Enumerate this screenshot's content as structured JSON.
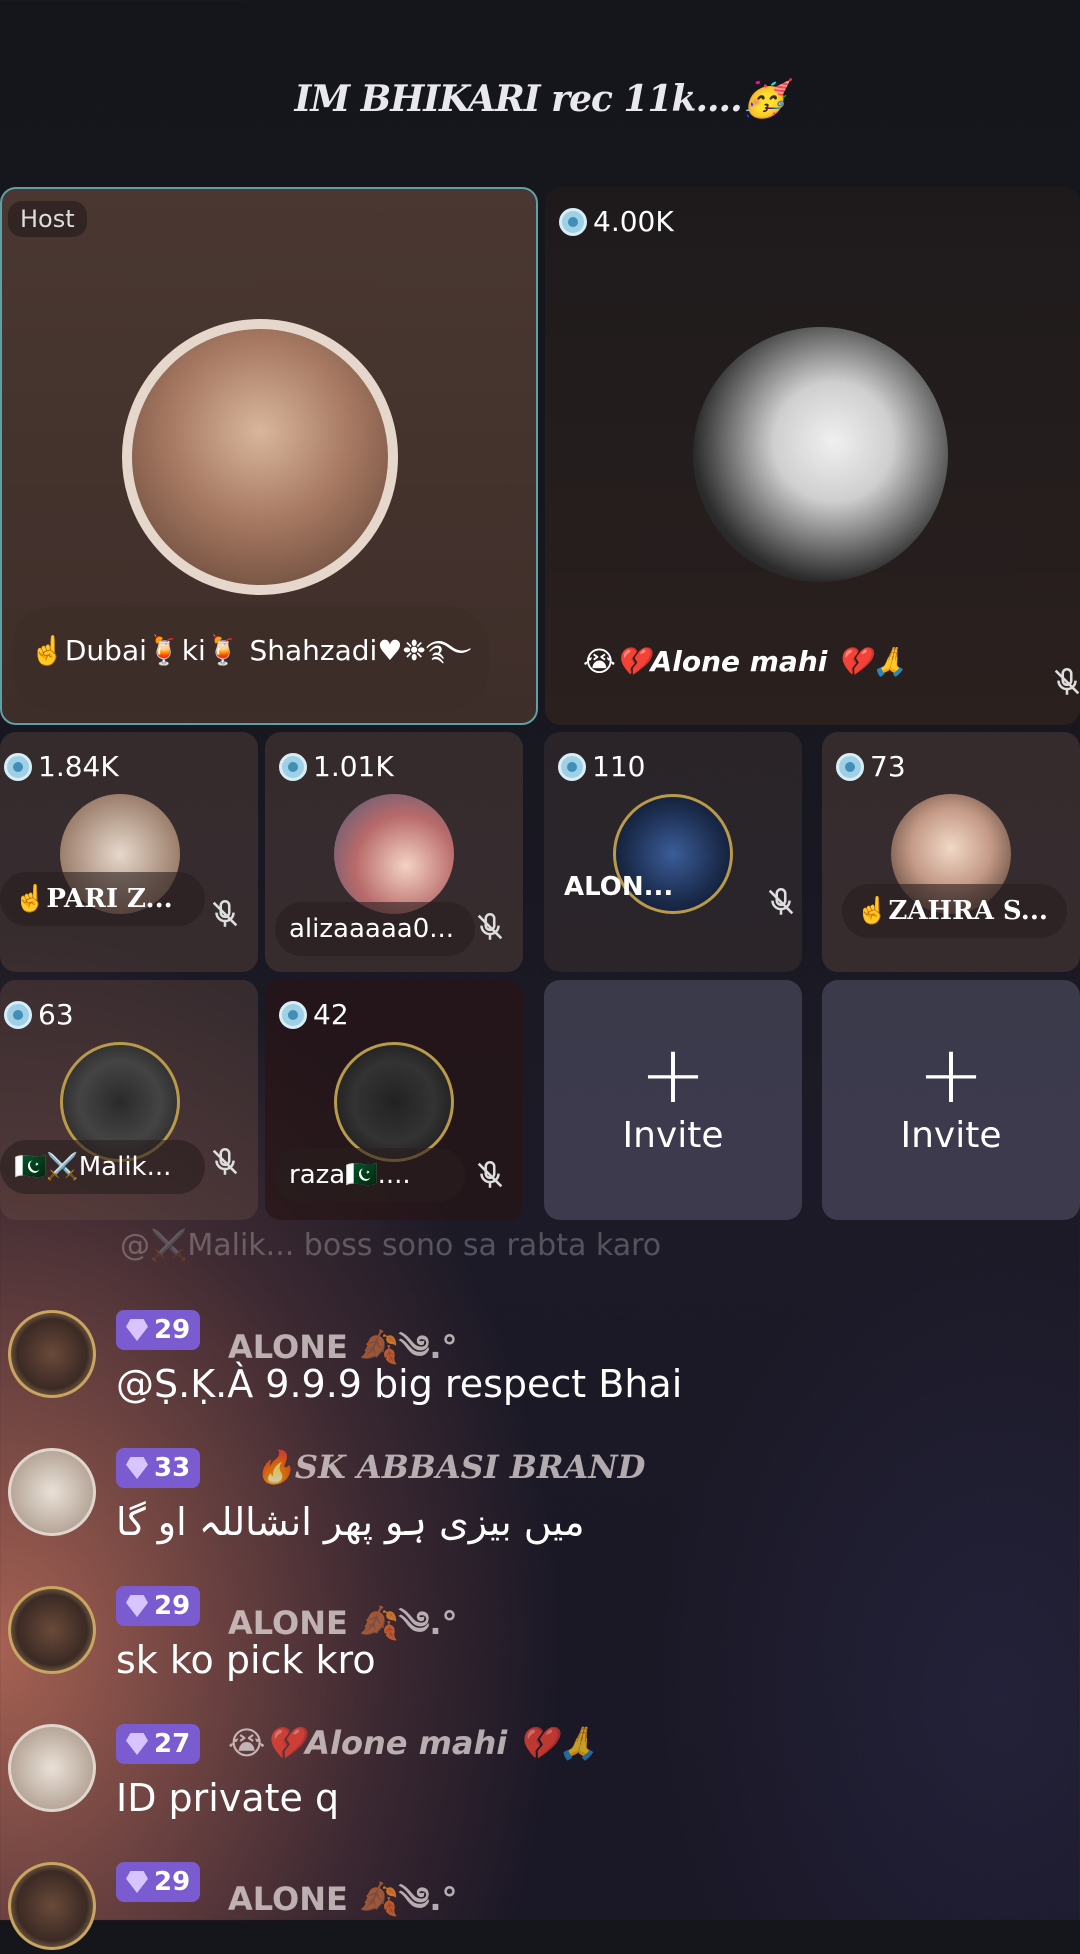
{
  "room": {
    "title": "IM BHIKARI rec 11k....🥳"
  },
  "host": {
    "label": "Host",
    "name": "☝️Dubai🍹ki🍹 Shahzadi♥︎❉࿐"
  },
  "seat2": {
    "coins": "4.00K",
    "name": "😭💔Alone mahi 💔🙏"
  },
  "seats": [
    {
      "coins": "1.84K",
      "name": "☝️PARI Z..."
    },
    {
      "coins": "1.01K",
      "name": "alizaaaaa0..."
    },
    {
      "coins": "110",
      "name": "ALON..."
    },
    {
      "coins": "73",
      "name": "☝️ZAHRA S..."
    },
    {
      "coins": "63",
      "name": "🇵🇰⚔️Malik..."
    },
    {
      "coins": "42",
      "name": "raza🇵🇰...."
    }
  ],
  "invite": {
    "plus": "+",
    "label": "Invite"
  },
  "chat": {
    "ghost": "@⚔️Malik... boss sono sa rabta karo",
    "messages": [
      {
        "level": "29",
        "user": "ALONE 🍂༄.°",
        "text": "@Ṣ.Ḳ.À 9.9.9 big respect Bhai"
      },
      {
        "level": "33",
        "user": "🔥SK ABBASI BRAND",
        "text": "میں بیزی ہو پھر انشاللہ او گا"
      },
      {
        "level": "29",
        "user": "ALONE 🍂༄.°",
        "text": "sk ko pick kro"
      },
      {
        "level": "27",
        "user": "😭💔Alone mahi 💔🙏",
        "text": "ID private q"
      },
      {
        "level": "29",
        "user": "ALONE 🍂༄.°",
        "text": ""
      }
    ]
  },
  "colors": {
    "host_border": "#5fa0a6",
    "level_badge": "#7a5bd0",
    "coin": "#9fd0e6"
  }
}
